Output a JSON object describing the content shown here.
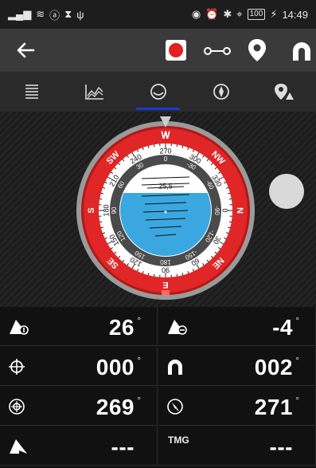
{
  "status_bar": {
    "battery": "100",
    "time": "14:49"
  },
  "toolbar": {
    "icons": [
      "back-arrow-icon",
      "record-icon",
      "key-icon",
      "location-pin-icon",
      "magnet-icon"
    ],
    "record_color": "#e12020"
  },
  "tabs": [
    {
      "icon": "list-icon"
    },
    {
      "icon": "chart-icon"
    },
    {
      "icon": "level-icon",
      "active": true
    },
    {
      "icon": "compass-icon"
    },
    {
      "icon": "map-marker-icon"
    }
  ],
  "compass": {
    "top_marker": "W",
    "ring_cardinals": [
      "W",
      "NW",
      "N",
      "NE",
      "E",
      "SE",
      "S",
      "SW"
    ],
    "ring_bearings": [
      "270",
      "300",
      "330",
      "0",
      "30",
      "60",
      "90",
      "120",
      "150",
      "180",
      "210",
      "240"
    ],
    "inner_scale": [
      "0",
      "-30",
      "-60",
      "-90",
      "-120",
      "-150",
      "180",
      "150",
      "120",
      "90",
      "60",
      "30"
    ],
    "pitch_label": "25,5"
  },
  "readings": [
    {
      "icon": "heel-port-icon",
      "value": "26",
      "unit": "°"
    },
    {
      "icon": "heel-starboard-icon",
      "value": "-4",
      "unit": "°"
    },
    {
      "icon": "crosshair-icon",
      "value": "000",
      "unit": "°"
    },
    {
      "icon": "magnet-icon",
      "value": "002",
      "unit": "°"
    },
    {
      "icon": "target-icon",
      "value": "269",
      "unit": "°"
    },
    {
      "icon": "compass-dial-icon",
      "value": "271",
      "unit": "°"
    },
    {
      "icon": "heel-icon",
      "value": "---",
      "unit": ""
    },
    {
      "label": "TMG",
      "value": "---",
      "unit": ""
    }
  ]
}
